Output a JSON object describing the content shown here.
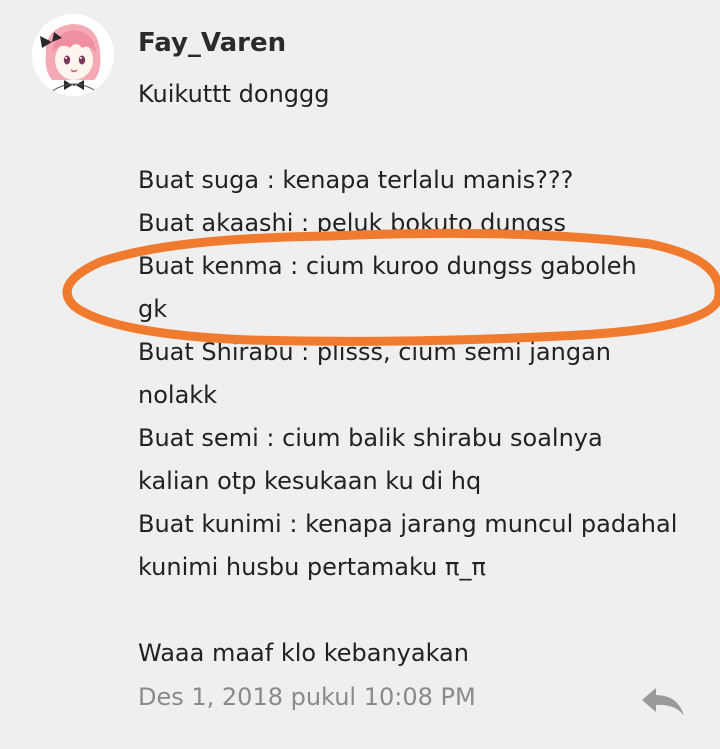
{
  "comment": {
    "username": "Fay_Varen",
    "lines": [
      "Kuikuttt donggg",
      "",
      "Buat suga : kenapa terlalu manis???",
      "Buat akaashi : peluk bokuto dungss",
      "Buat kenma : cium kuroo dungss gaboleh",
      "gk",
      "Buat Shirabu : plisss, cium semi jangan",
      "nolakk",
      "Buat semi : cium balik shirabu soalnya",
      "kalian otp kesukaan ku di hq",
      "Buat kunimi : kenapa jarang muncul padahal",
      "kunimi husbu pertamaku π_π",
      "",
      "Waaa maaf klo kebanyakan"
    ],
    "timestamp": "Des 1, 2018 pukul 10:08 PM"
  },
  "icons": {
    "avatar": "anime-avatar-icon",
    "reply": "reply-arrow-icon"
  },
  "colors": {
    "background": "#efefef",
    "text": "#222222",
    "timestamp": "#8a8a8a",
    "annotation_ellipse": "#f07a2e",
    "reply_icon": "#9a9a9a"
  }
}
